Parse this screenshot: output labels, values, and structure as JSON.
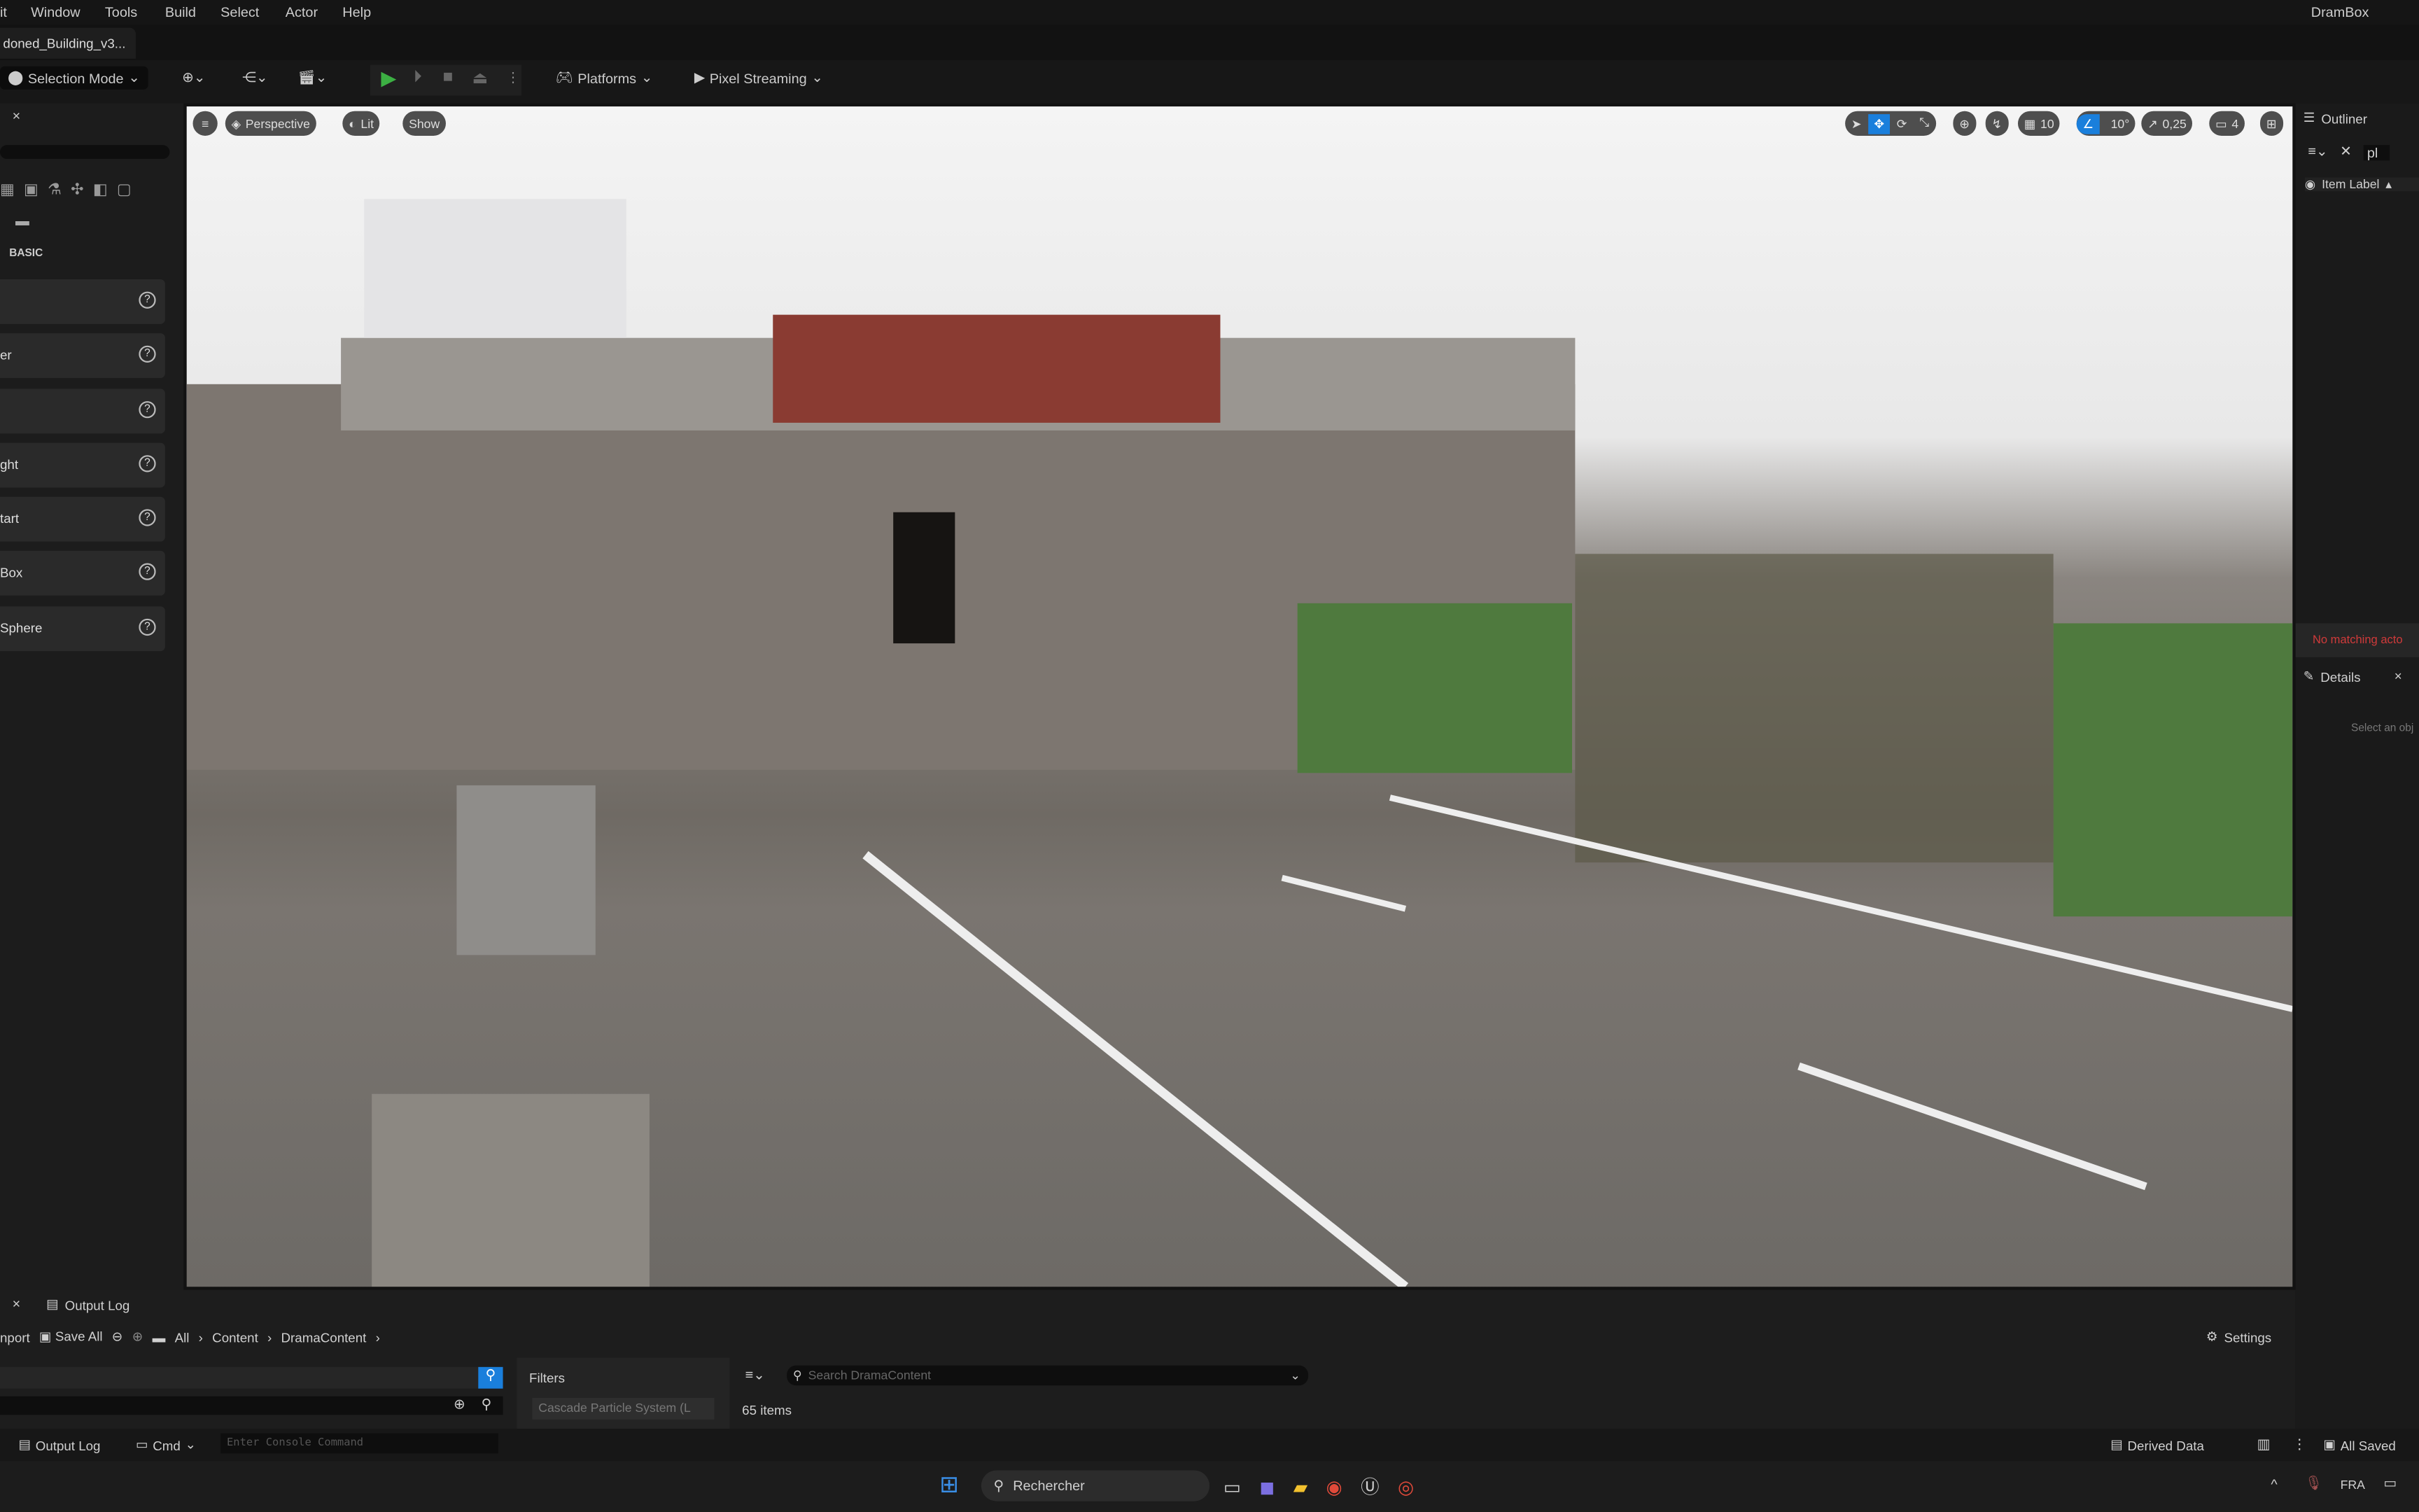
{
  "menu": {
    "items": [
      "it",
      "Window",
      "Tools",
      "Build",
      "Select",
      "Actor",
      "Help"
    ],
    "project": "DramBox"
  },
  "tab": {
    "label": "doned_Building_v3..."
  },
  "toolbar": {
    "selection_mode": "Selection Mode",
    "platforms": "Platforms",
    "pixel_streaming": "Pixel Streaming"
  },
  "viewport": {
    "perspective": "Perspective",
    "lit": "Lit",
    "show": "Show",
    "grid_snap": "10",
    "rotation_snap": "10°",
    "scale_snap": "0,25",
    "camera_speed": "4"
  },
  "left_panel": {
    "section": "BASIC",
    "items": [
      "",
      "er",
      "",
      "ght",
      "tart",
      "Box",
      "Sphere"
    ]
  },
  "outliner": {
    "title": "Outliner",
    "search_value": "pl",
    "column": "Item Label",
    "no_match": "No matching acto"
  },
  "details": {
    "title": "Details",
    "hint": "Select an obj"
  },
  "bottom": {
    "tab": "Output Log",
    "import": "nport",
    "save_all": "Save All",
    "breadcrumb": [
      "All",
      "Content",
      "DramaContent"
    ],
    "settings": "Settings",
    "filters": "Filters",
    "filter_chip": "Cascade Particle System (L",
    "search_placeholder": "Search DramaContent",
    "item_count": "65 items"
  },
  "status": {
    "output_log": "Output Log",
    "cmd": "Cmd",
    "console_placeholder": "Enter Console Command",
    "derived_data": "Derived Data",
    "all_saved": "All Saved"
  },
  "taskbar": {
    "search": "Rechercher",
    "lang": "FRA"
  },
  "colors": {
    "accent": "#1a7fdc",
    "play": "#3cb043",
    "error": "#d03a3a"
  }
}
